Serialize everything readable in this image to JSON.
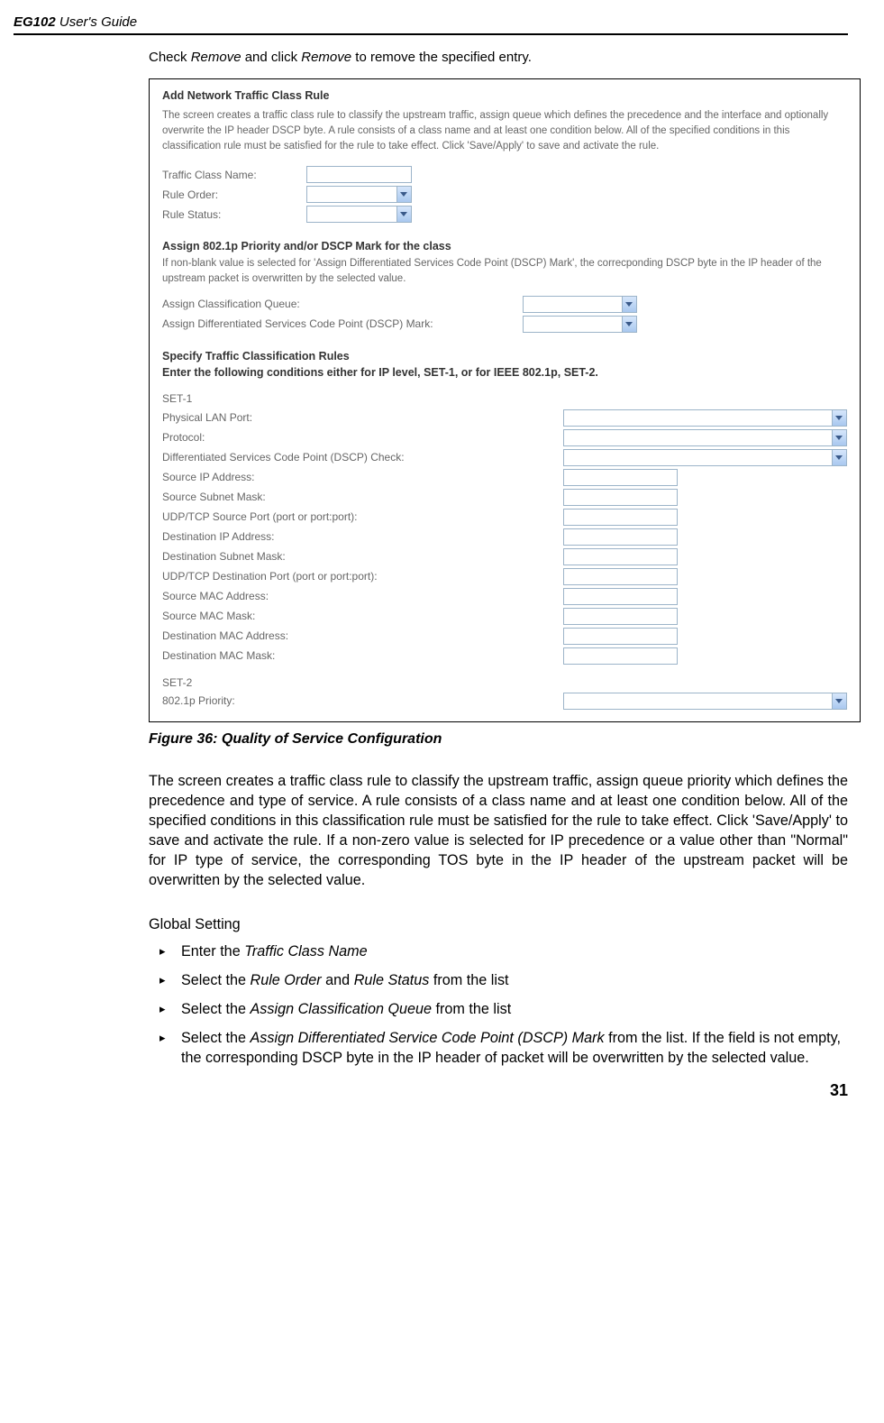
{
  "header": {
    "model": "EG102",
    "guide": " User's Guide"
  },
  "intro": {
    "pre": "Check ",
    "em1": "Remove",
    "mid": " and click ",
    "em2": "Remove",
    "post": " to remove the specified entry."
  },
  "screenshot": {
    "title": "Add Network Traffic Class Rule",
    "desc": "The screen creates a traffic class rule to classify the upstream traffic, assign queue which defines the precedence and the interface and optionally overwrite the IP header DSCP byte. A rule consists of a class name and at least one condition below. All of the specified conditions in this classification rule must be satisfied for the rule to take effect. Click 'Save/Apply' to save and activate the rule.",
    "rows1": {
      "name": "Traffic Class Name:",
      "order": "Rule Order:",
      "status": "Rule Status:"
    },
    "assign": {
      "head": "Assign 802.1p Priority and/or DSCP Mark for the class",
      "desc": "If non-blank value is selected for 'Assign Differentiated Services Code Point (DSCP) Mark', the correcponding DSCP byte in the IP header of the upstream packet is overwritten by the selected value.",
      "queue": "Assign Classification Queue:",
      "dscp": "Assign Differentiated Services Code Point (DSCP) Mark:"
    },
    "specify": {
      "head": "Specify Traffic Classification Rules",
      "sub": "Enter the following conditions either for IP level, SET-1, or for IEEE 802.1p, SET-2."
    },
    "set1": {
      "label": "SET-1",
      "lan": "Physical LAN Port:",
      "proto": "Protocol:",
      "dscp": "Differentiated Services Code Point (DSCP) Check:",
      "sip": "Source IP Address:",
      "smask": "Source Subnet Mask:",
      "sport": "UDP/TCP Source Port (port or port:port):",
      "dip": "Destination IP Address:",
      "dmask": "Destination Subnet Mask:",
      "dport": "UDP/TCP Destination Port (port or port:port):",
      "smac": "Source MAC Address:",
      "smmask": "Source MAC Mask:",
      "dmac": "Destination MAC Address:",
      "dmmask": "Destination MAC Mask:"
    },
    "set2": {
      "label": "SET-2",
      "prio": "802.1p Priority:"
    }
  },
  "caption": "Figure 36: Quality of Service Configuration",
  "para": "The screen creates a traffic class rule to classify the upstream traffic, assign queue priority which defines the precedence and type of service. A rule consists of a class name and at least one condition below. All of the specified conditions in this classification rule must be satisfied for the rule to take effect. Click 'Save/Apply' to save and activate the rule. If a non-zero value is selected for IP precedence or a value other than \"Normal\" for IP type of service, the corresponding TOS byte in the IP header of the upstream packet will be overwritten by the selected value.",
  "global": {
    "head": "Global Setting",
    "b1": {
      "pre": "Enter the ",
      "em": "Traffic Class Name"
    },
    "b2": {
      "pre": "Select the ",
      "em1": "Rule Order",
      "mid": " and ",
      "em2": "Rule Status",
      "post": " from the list"
    },
    "b3": {
      "pre": "Select the ",
      "em": "Assign Classification Queue",
      "post": " from the list"
    },
    "b4": {
      "pre": "Select the ",
      "em": "Assign Differentiated Service Code Point (DSCP) Mark",
      "post": " from the list. If the field is not empty, the corresponding DSCP byte in the IP header of packet will be overwritten by the selected value."
    }
  },
  "pageNum": "31"
}
